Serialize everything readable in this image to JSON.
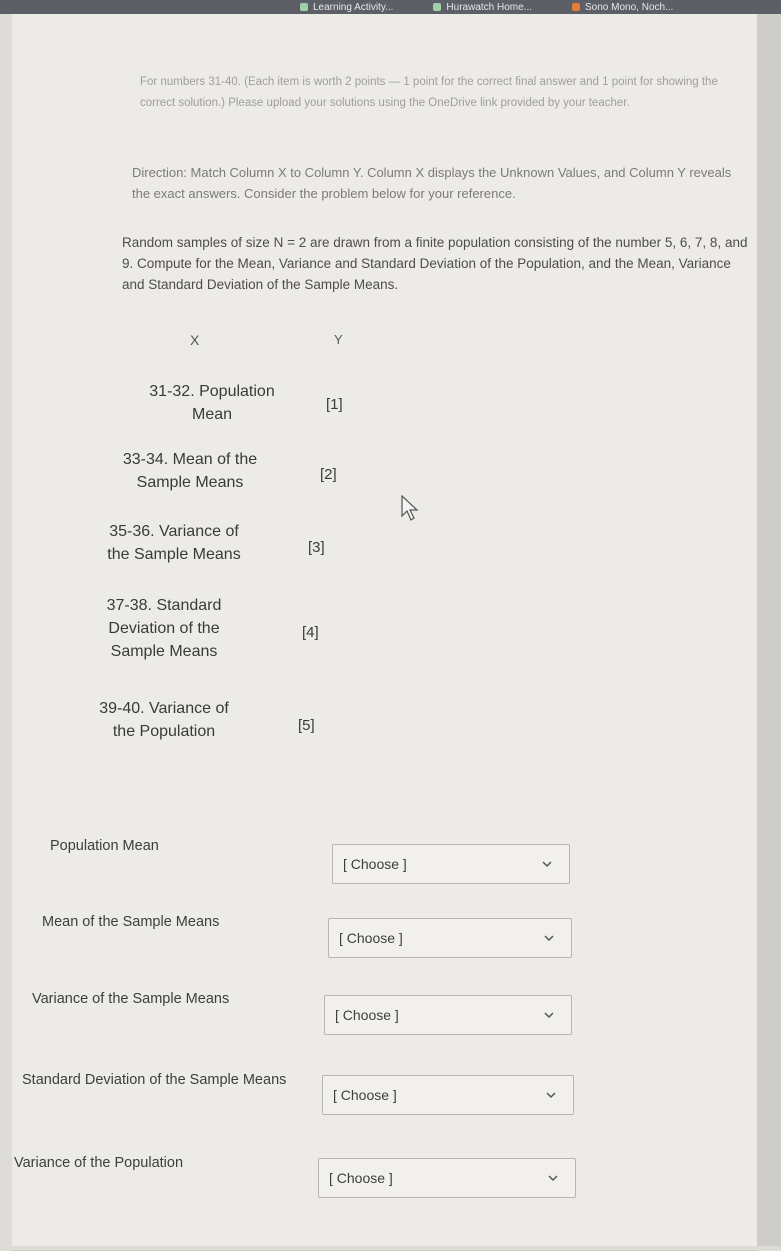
{
  "browser": {
    "tabs": [
      "Learning Activity...",
      "Hurawatch Home...",
      "Sono Mono, Noch..."
    ]
  },
  "intro": {
    "points": "For numbers 31-40. (Each item is worth 2 points — 1 point for the correct final answer and 1 point for showing the correct solution.) Please upload your solutions using the OneDrive link provided by your teacher.",
    "direction": "Direction: Match Column X to Column Y. Column X displays the Unknown Values, and Column Y reveals the exact answers. Consider the problem below for your reference.",
    "problem": "Random samples of size N = 2 are drawn from a finite population consisting of the number 5, 6, 7, 8, and 9. Compute for the Mean, Variance and Standard Deviation of the Population, and the Mean, Variance and Standard Deviation of the Sample Means."
  },
  "columns": {
    "x": "X",
    "y": "Y"
  },
  "rows": [
    {
      "x": [
        "31-32. Population",
        "Mean"
      ],
      "y": "[1]"
    },
    {
      "x": [
        "33-34. Mean of the",
        "Sample Means"
      ],
      "y": "[2]"
    },
    {
      "x": [
        "35-36. Variance of",
        "the Sample Means"
      ],
      "y": "[3]"
    },
    {
      "x": [
        "37-38. Standard",
        "Deviation of the",
        "Sample Means"
      ],
      "y": "[4]"
    },
    {
      "x": [
        "39-40. Variance of",
        "the Population"
      ],
      "y": "[5]"
    }
  ],
  "questions": [
    {
      "label": "Population Mean",
      "selected": "[ Choose ]"
    },
    {
      "label": "Mean of the Sample Means",
      "selected": "[ Choose ]"
    },
    {
      "label": "Variance of the Sample Means",
      "selected": "[ Choose ]"
    },
    {
      "label": "Standard Deviation of the Sample Means",
      "selected": "[ Choose ]"
    },
    {
      "label": "Variance of the Population",
      "selected": "[ Choose ]"
    }
  ]
}
